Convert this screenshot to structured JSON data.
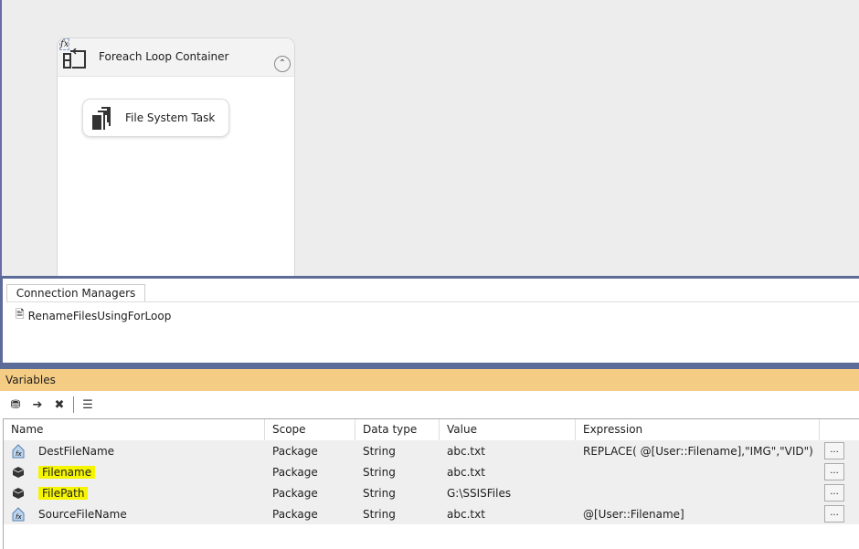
{
  "canvas": {
    "container_title": "Foreach Loop Container",
    "fx_label": "fx",
    "task_label": "File System Task"
  },
  "connection_managers": {
    "tab_label": "Connection Managers",
    "items": [
      "RenameFilesUsingForLoop"
    ]
  },
  "variables": {
    "title": "Variables",
    "columns": [
      "Name",
      "Scope",
      "Data type",
      "Value",
      "Expression"
    ],
    "rows": [
      {
        "name": "DestFileName",
        "scope": "Package",
        "type": "String",
        "value": "abc.txt",
        "expression": "REPLACE( @[User::Filename],\"IMG\",\"VID\")",
        "icon": "expression-variable-icon",
        "highlighted": false
      },
      {
        "name": "Filename",
        "scope": "Package",
        "type": "String",
        "value": "abc.txt",
        "expression": "",
        "icon": "variable-icon",
        "highlighted": true
      },
      {
        "name": "FilePath",
        "scope": "Package",
        "type": "String",
        "value": "G:\\SSISFiles",
        "expression": "",
        "icon": "variable-icon",
        "highlighted": true
      },
      {
        "name": "SourceFileName",
        "scope": "Package",
        "type": "String",
        "value": "abc.txt",
        "expression": "@[User::Filename]",
        "icon": "expression-variable-icon",
        "highlighted": false
      }
    ],
    "ellipsis": "...",
    "highlight_color": "#f5f500"
  }
}
